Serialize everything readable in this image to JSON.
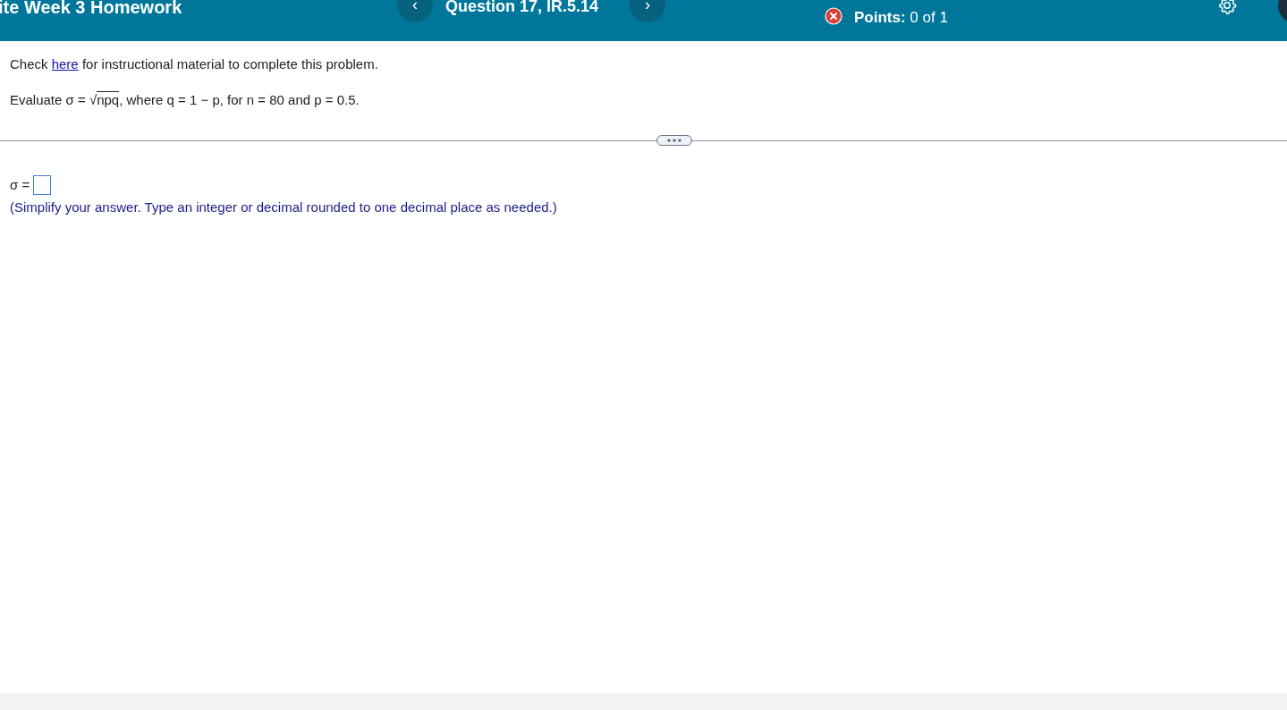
{
  "header": {
    "title": "ite Week 3 Homework",
    "prev_button": "‹",
    "question": "Question 17, IR.5.14",
    "next_button": "›",
    "points_label": "Points:",
    "points_value": "0 of 1"
  },
  "instruction": {
    "before": "Check ",
    "link": "here",
    "after": " for instructional material to complete this problem."
  },
  "problem": {
    "before": "Evaluate σ = ",
    "radical": "√",
    "radicand": "npq",
    "after": ", where q = 1 − p, for n = 80 and p = 0.5."
  },
  "answer": {
    "label": "σ =",
    "hint": "(Simplify your answer. Type an integer or decimal rounded to one decimal place as needed.)"
  }
}
